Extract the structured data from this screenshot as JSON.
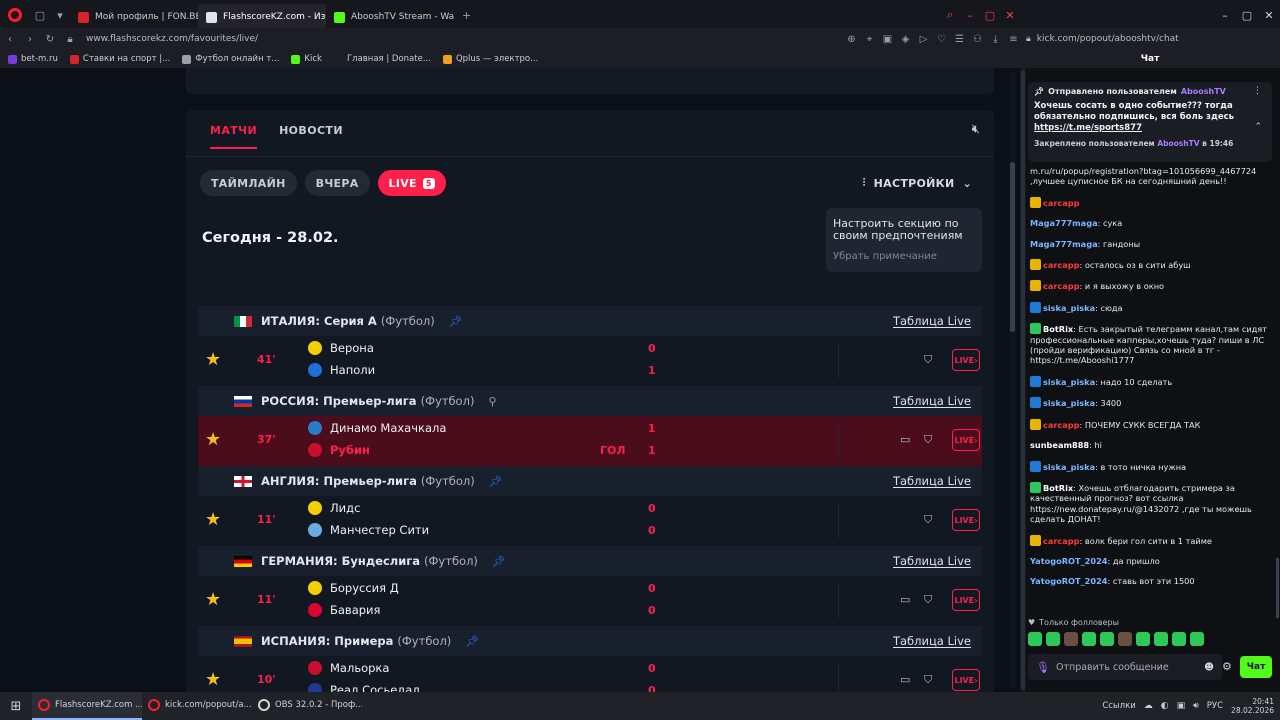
{
  "browser": {
    "tabs": [
      {
        "label": "Мой профиль | FON.BET",
        "fav_color": "#d8232a",
        "active": false
      },
      {
        "label": "FlashscoreKZ.com - Избр",
        "fav_color": "#e0e3ea",
        "active": true
      },
      {
        "label": "AbooshTV Stream - Watch",
        "fav_color": "#53fc18",
        "active": false
      }
    ],
    "url": "www.flashscorekz.com/favourites/live/",
    "popup_url": "kick.com/popout/abooshtv/chat",
    "bookmarks": [
      {
        "label": "bet-m.ru",
        "fav_color": "#7a3bd8"
      },
      {
        "label": "Ставки на спорт |...",
        "fav_color": "#d8232a"
      },
      {
        "label": "Футбол онлайн т...",
        "fav_color": "#9aa0ab"
      },
      {
        "label": "Kick",
        "fav_color": "#53fc18"
      },
      {
        "label": "Главная | Donate...",
        "fav_color": "#1d1e25"
      },
      {
        "label": "Qplus — электро...",
        "fav_color": "#f0a020"
      }
    ],
    "chat_header": "Чат"
  },
  "page": {
    "tab_matches": "МАТЧИ",
    "tab_news": "НОВОСТИ",
    "pill_timeline": "ТАЙМЛАЙН",
    "pill_yesterday": "ВЧЕРА",
    "pill_live": "LIVE",
    "live_count": "5",
    "settings_label": "НАСТРОЙКИ",
    "tooltip_text": "Настроить секцию по своим предпочтениям",
    "tooltip_dismiss": "Убрать примечание",
    "date_label": "Сегодня - 28.02.",
    "table_link": "Таблица Live",
    "sport_label": "(Футбол)",
    "live_btn": "LIVE›",
    "goal_label": "ГОЛ"
  },
  "leagues": [
    {
      "name": "ИТАЛИЯ: Серия А",
      "pinned": true,
      "match": {
        "minute": "41'",
        "home": "Верона",
        "away": "Наполи",
        "home_score": "0",
        "away_score": "1",
        "goal": false,
        "tv": false
      }
    },
    {
      "name": "РОССИЯ: Премьер-лига",
      "pinned": false,
      "match": {
        "minute": "37'",
        "home": "Динамо Махачкала",
        "away": "Рубин",
        "home_score": "1",
        "away_score": "1",
        "goal": true,
        "tv": true
      }
    },
    {
      "name": "АНГЛИЯ: Премьер-лига",
      "pinned": true,
      "match": {
        "minute": "11'",
        "home": "Лидс",
        "away": "Манчестер Сити",
        "home_score": "0",
        "away_score": "0",
        "goal": false,
        "tv": false
      }
    },
    {
      "name": "ГЕРМАНИЯ: Бундеслига",
      "pinned": true,
      "match": {
        "minute": "11'",
        "home": "Боруссия Д",
        "away": "Бавария",
        "home_score": "0",
        "away_score": "0",
        "goal": false,
        "tv": true
      }
    },
    {
      "name": "ИСПАНИЯ: Примера",
      "pinned": true,
      "match": {
        "minute": "10'",
        "home": "Мальорка",
        "away": "Реал Сосьедад",
        "home_score": "0",
        "away_score": "0",
        "goal": false,
        "tv": true
      }
    }
  ],
  "chat": {
    "pinned_by_label": "Отправлено пользователем",
    "pinned_user": "AbooshTV",
    "pinned_text": "Хочешь сосать в одно событие??? тогда обязательно подпишись, вся боль здесь",
    "pinned_link": "https://t.me/sports877",
    "pinned_foot_label": "Закреплено пользователем",
    "pinned_foot_time": "в 19:46",
    "messages": [
      {
        "user": "",
        "text": "m.ru/ru/popup/registration?btag=101056699_4467724 ,лучшее цуписное БК на сегодняшний день!!",
        "badge": "",
        "ucolor": "u-white"
      },
      {
        "user": "carcapp",
        "text": "",
        "badge": "crown",
        "ucolor": "u-red"
      },
      {
        "user": "Maga777maga",
        "text": ": сука",
        "badge": "",
        "ucolor": "u-cyan"
      },
      {
        "user": "Maga777maga",
        "text": ": гандоны",
        "badge": "",
        "ucolor": "u-cyan"
      },
      {
        "user": "carcapp",
        "text": ": осталось оз в сити абуш",
        "badge": "crown",
        "ucolor": "u-red"
      },
      {
        "user": "carcapp",
        "text": ": и я выхожу в окно",
        "badge": "crown",
        "ucolor": "u-red"
      },
      {
        "user": "siska_piska",
        "text": ": сюда",
        "badge": "blue",
        "ucolor": "u-cyan"
      },
      {
        "user": "BotRix",
        "text": ": Есть закрытый телеграмм канал,там сидят профессиональные капперы,хочешь туда? пиши в ЛС (пройди верификацию) Связь со мной в тг - https://t.me/Abooshi1777",
        "badge": "green",
        "ucolor": "u-white"
      },
      {
        "user": "siska_piska",
        "text": ": надо 10 сделать",
        "badge": "blue",
        "ucolor": "u-cyan"
      },
      {
        "user": "siska_piska",
        "text": ": 3400",
        "badge": "blue",
        "ucolor": "u-cyan"
      },
      {
        "user": "carcapp",
        "text": ": ПОЧЕМУ СУКК ВСЕГДА ТАК",
        "badge": "crown",
        "ucolor": "u-red"
      },
      {
        "user": "sunbeam888",
        "text": ": hi",
        "badge": "",
        "ucolor": "u-white"
      },
      {
        "user": "siska_piska",
        "text": ": в тото ничка нужна",
        "badge": "blue",
        "ucolor": "u-cyan"
      },
      {
        "user": "BotRix",
        "text": ": Хочешь отблагодарить стримера за качественный прогноз? вот ссылка https://new.donatepay.ru/@1432072 ,где ты можешь сделать ДОНАТ!",
        "badge": "green",
        "ucolor": "u-white"
      },
      {
        "user": "carcapp",
        "text": ": волк бери гол сити в 1 тайме",
        "badge": "crown",
        "ucolor": "u-red"
      },
      {
        "user": "YatogoROT_2024",
        "text": ": да пришло",
        "badge": "",
        "ucolor": "u-cyan"
      },
      {
        "user": "YatogoROT_2024",
        "text": ": ставь вот эти 1500",
        "badge": "",
        "ucolor": "u-cyan"
      }
    ],
    "followers_only": "Только фолловеры",
    "input_placeholder": "Отправить сообщение",
    "send_label": "Чат"
  },
  "taskbar": {
    "items": [
      "FlashscoreKZ.com ...",
      "kick.com/popout/a...",
      "OBS 32.0.2 - Проф..."
    ],
    "tray_links": "Ссылки",
    "tray_lang": "РУС",
    "time": "20:41",
    "date": "28.02.2026"
  }
}
